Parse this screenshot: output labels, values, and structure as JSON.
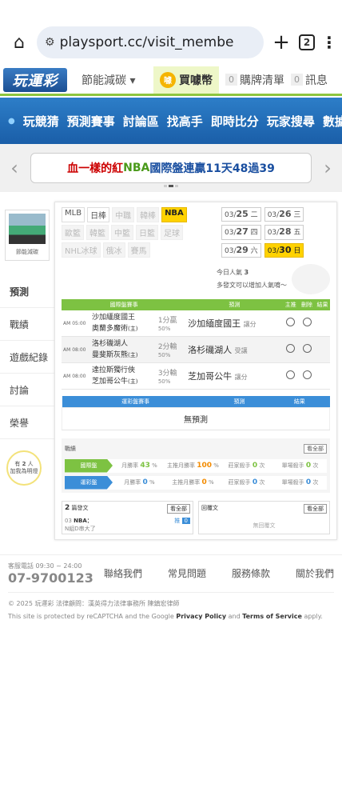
{
  "browser": {
    "url": "playsport.cc/visit_membe",
    "tab_count": "2",
    "home_icon": "home-icon",
    "menu_icon": "more-vert-icon"
  },
  "site": {
    "logo": "玩運彩",
    "energy": "節能減碳 ▾",
    "buy": "買噱幣",
    "coin": "噱",
    "cart_count": "0",
    "cart": "購牌清單",
    "msg_count": "0",
    "msg": "訊息"
  },
  "nav": [
    "玩競猜",
    "預測賽事",
    "討論區",
    "找高手",
    "即時比分",
    "玩家搜尋",
    "數據"
  ],
  "banner": {
    "part1": "血一樣的紅 ",
    "part2": "NBA",
    "part3": " 國際盤連贏11天48過39"
  },
  "profile": {
    "name": "節能減碳"
  },
  "left_menu": [
    "預測",
    "戰績",
    "遊戲紀錄",
    "討論",
    "榮譽"
  ],
  "bulb": {
    "line1": "有",
    "count": "2",
    "unit": "人",
    "line2": "加我為明燈"
  },
  "leagues": [
    {
      "label": "MLB",
      "state": "normal"
    },
    {
      "label": "日棒",
      "state": "normal"
    },
    {
      "label": "中職",
      "state": "faded"
    },
    {
      "label": "韓棒",
      "state": "faded"
    },
    {
      "label": "NBA",
      "state": "sel"
    },
    {
      "label": "歐籃",
      "state": "faded"
    },
    {
      "label": "韓籃",
      "state": "faded"
    },
    {
      "label": "中籃",
      "state": "faded"
    },
    {
      "label": "日籃",
      "state": "faded"
    },
    {
      "label": "足球",
      "state": "faded"
    },
    {
      "label": "NHL冰球",
      "state": "faded"
    },
    {
      "label": "俄冰",
      "state": "faded"
    },
    {
      "label": "賽馬",
      "state": "faded"
    }
  ],
  "dates": [
    {
      "d": "03/",
      "n": "25",
      "w": "二",
      "sel": false
    },
    {
      "d": "03/",
      "n": "26",
      "w": "三",
      "sel": false
    },
    {
      "d": "03/",
      "n": "27",
      "w": "四",
      "sel": false
    },
    {
      "d": "03/",
      "n": "28",
      "w": "五",
      "sel": false
    },
    {
      "d": "03/",
      "n": "29",
      "w": "六",
      "sel": false
    },
    {
      "d": "03/",
      "n": "30",
      "w": "日",
      "sel": true
    }
  ],
  "popular": {
    "label": "今日人氣",
    "count": "3",
    "hint": "多發文可以增加人氣唷～"
  },
  "intl_table": {
    "header": [
      "國際盤賽事",
      "預測",
      "主推",
      "刪除",
      "結果"
    ],
    "rows": [
      {
        "time": "AM 05:00",
        "t1": "沙加緬度國王",
        "t2": "奧蘭多魔術",
        "t2_sub": "(主)",
        "odds": "1分贏",
        "pct": "50%",
        "pick": "沙加緬度國王",
        "pick_note": "讓分"
      },
      {
        "time": "AM 08:00",
        "t1": "洛杉磯湖人",
        "t2": "曼斐斯灰熊",
        "t2_sub": "(主)",
        "odds": "2分輸",
        "pct": "50%",
        "pick": "洛杉磯湖人",
        "pick_note": "受讓"
      },
      {
        "time": "AM 08:00",
        "t1": "達拉斯獨行俠",
        "t2": "芝加哥公牛",
        "t2_sub": "(主)",
        "odds": "3分輸",
        "pct": "50%",
        "pick": "芝加哥公牛",
        "pick_note": "讓分"
      }
    ]
  },
  "lottery_table": {
    "header": [
      "運彩盤賽事",
      "預測",
      "結果"
    ],
    "empty": "無預測"
  },
  "stats": {
    "title": "戰績",
    "all": "看全部",
    "rows": [
      {
        "tag": "國際盤",
        "c1": "月勝率",
        "v1": "43",
        "u1": "%",
        "c2": "主推月勝率",
        "v2": "100",
        "u2": "%",
        "c3": "莊家殺手",
        "v3": "0",
        "u3": "次",
        "c4": "單場殺手",
        "v4": "0",
        "u4": "次"
      },
      {
        "tag": "運彩盤",
        "c1": "月勝率",
        "v1": "0",
        "u1": "%",
        "c2": "主推月勝率",
        "v2": "0",
        "u2": "%",
        "c3": "莊家殺手",
        "v3": "0",
        "u3": "次",
        "c4": "單場殺手",
        "v4": "0",
        "u4": "次"
      }
    ]
  },
  "posts": {
    "count": "2",
    "label": "篇發文",
    "all": "看全部",
    "item_num": "03",
    "item_title": "NBA：",
    "item_sub": "N組D串大了",
    "item_badge": "推",
    "item_count": "0"
  },
  "replies": {
    "label": "回覆文",
    "all": "看全部",
    "empty": "無回覆文"
  },
  "footer": {
    "phone_label": "客服電話 09:30 ~ 24:00",
    "phone": "07-9700123",
    "links": [
      "聯絡我們",
      "常見問題",
      "服務條款",
      "關於我們"
    ],
    "copyright": "© 2025 玩運彩 法律顧問：漢英得力法律事務所 陳鎮宏律師",
    "recaptcha_pre": "This site is protected by reCAPTCHA and the Google ",
    "privacy": "Privacy Policy",
    "and": " and ",
    "terms": "Terms of Service",
    "apply": " apply."
  }
}
